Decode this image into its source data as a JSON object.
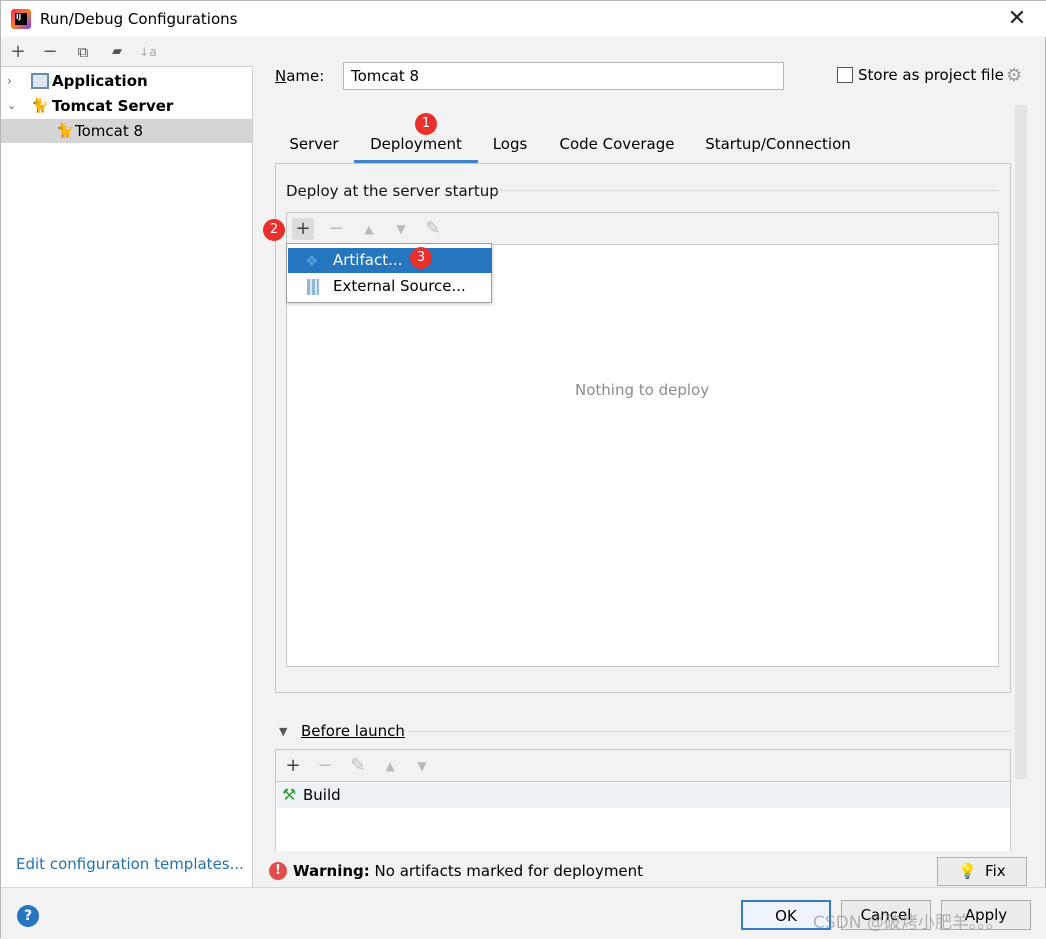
{
  "window": {
    "title": "Run/Debug Configurations",
    "close_glyph": "✕"
  },
  "left_toolbar": {
    "add": "+",
    "remove": "−",
    "copy": "⧉",
    "folder": "▰",
    "sort": "↓a"
  },
  "tree": [
    {
      "label": "Application",
      "expanded": false,
      "bold": true
    },
    {
      "label": "Tomcat Server",
      "expanded": true,
      "bold": true
    },
    {
      "label": "Tomcat 8",
      "selected": true
    }
  ],
  "edit_templates": "Edit configuration templates...",
  "name": {
    "label_prefix": "N",
    "label_rest": "ame:",
    "value": "Tomcat 8"
  },
  "store": {
    "label": "Store as project file",
    "checked": false
  },
  "tabs": [
    "Server",
    "Deployment",
    "Logs",
    "Code Coverage",
    "Startup/Connection"
  ],
  "active_tab": "Deployment",
  "deploy": {
    "section_title": "Deploy at the server startup",
    "empty_text": "Nothing to deploy",
    "toolbar": {
      "add": "+",
      "remove": "−",
      "up": "▲",
      "down": "▼",
      "edit": "✎"
    },
    "popup": [
      {
        "label": "Artifact...",
        "icon": "artifact-icon",
        "selected": true
      },
      {
        "label": "External Source...",
        "icon": "external-source-icon",
        "selected": false
      }
    ]
  },
  "badges": [
    "1",
    "2",
    "3"
  ],
  "before_launch": {
    "label": "Before launch",
    "toolbar": {
      "add": "+",
      "remove": "−",
      "edit": "✎",
      "up": "▲",
      "down": "▼"
    },
    "items": [
      {
        "label": "Build",
        "icon": "hammer-icon"
      }
    ]
  },
  "warning": {
    "bold": "Warning:",
    "text": " No artifacts marked for deployment"
  },
  "fix_label": "Fix",
  "buttons": {
    "ok": "OK",
    "cancel": "Cancel",
    "apply": "Apply"
  },
  "help_glyph": "?",
  "watermark": "CSDN @破烤小肥羊。。。",
  "colors": {
    "accent": "#2675bf",
    "badge": "#e8302d",
    "link": "#2470b3"
  }
}
